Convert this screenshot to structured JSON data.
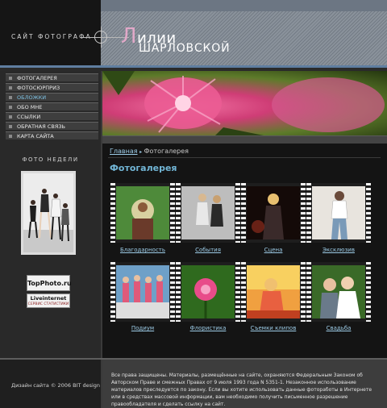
{
  "header": {
    "site_label": "САЙТ ФОТОГРАФА",
    "name_first_letter": "Л",
    "name_rest": "илии",
    "surname": "ШАРЛОВСКОЙ"
  },
  "menu": {
    "items": [
      {
        "label": "ФОТОГАЛЕРЕЯ"
      },
      {
        "label": "ФОТОСЮРПРИЗ"
      },
      {
        "label": "ОБЛОЖКИ"
      },
      {
        "label": "ОБО МНЕ"
      },
      {
        "label": "ССЫЛКИ"
      },
      {
        "label": "ОБРАТНАЯ СВЯЗЬ"
      },
      {
        "label": "КАРТА САЙТА"
      }
    ],
    "active_index": 2
  },
  "sidebar": {
    "week_title": "ФОТО НЕДЕЛИ",
    "badge1": "TopPhoto.ru",
    "badge2_line1": "Liveinternet",
    "badge2_line2": "СЕРВИС СТАТИСТИКИ"
  },
  "breadcrumb": {
    "home": "Главная",
    "separator": "▸",
    "current": "Фотогалерея"
  },
  "page_title": "Фотогалерея",
  "gallery": [
    {
      "label": "Благодарность"
    },
    {
      "label": "События"
    },
    {
      "label": "Сцена"
    },
    {
      "label": "Эксклюзив"
    },
    {
      "label": "Подиум"
    },
    {
      "label": "Флористика"
    },
    {
      "label": "Съемки клипов"
    },
    {
      "label": "Свадьба"
    }
  ],
  "footer": {
    "credit": "Дизайн сайта © 2006 BIT design",
    "notice": "Все права защищены. Материалы, размещённые на сайте, охраняются Федеральным Законом об Авторском Праве и смежных Правах от 9 июля 1993 года N 5351-1. Незаконное использование материалов преследуется по закону. Если вы хотите использовать данные фотоработы в Интернете или в средствах массовой информации, вам необходимо получить письменное разрешение правообладателя и сделать ссылку на сайт."
  },
  "colors": {
    "accent": "#72b6d6",
    "link": "#9ccbe6",
    "name_accent": "#e1a8c8"
  }
}
